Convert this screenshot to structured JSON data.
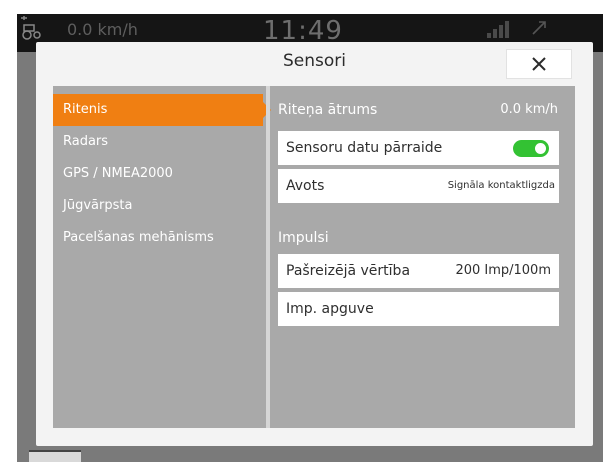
{
  "statusbar": {
    "speed": "0.0 km/h",
    "clock": "11:49"
  },
  "dialog": {
    "title": "Sensori",
    "close_icon": "close-icon"
  },
  "sidebar": {
    "items": [
      {
        "label": "Ritenis",
        "active": true
      },
      {
        "label": "Radars",
        "active": false
      },
      {
        "label": "GPS / NMEA2000",
        "active": false
      },
      {
        "label": "Jūgvārpsta",
        "active": false
      },
      {
        "label": "Pacelšanas mehānisms",
        "active": false
      }
    ]
  },
  "panel": {
    "wheel_speed": {
      "label": "Riteņa ātrums",
      "value": "0.0 km/h"
    },
    "sensor_transfer": {
      "label": "Sensoru datu pārraide",
      "enabled": true
    },
    "source": {
      "label": "Avots",
      "value": "Signāla kontaktligzda"
    },
    "impulses_heading": "Impulsi",
    "current_value": {
      "label": "Pašreizējā vērtība",
      "value": "200 Imp/100m"
    },
    "imp_learning": {
      "label": "Imp. apguve"
    }
  },
  "colors": {
    "accent": "#f07f12",
    "toggle_on": "#33c233",
    "content_bg": "#a9a9a9"
  }
}
